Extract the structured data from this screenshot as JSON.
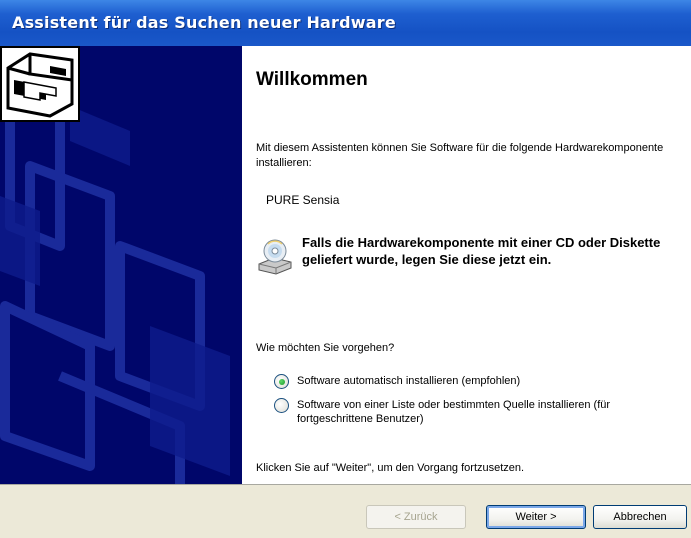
{
  "window": {
    "title": "Assistent für das Suchen neuer Hardware"
  },
  "content": {
    "heading": "Willkommen",
    "intro": "Mit diesem Assistenten können Sie Software für die folgende Hardwarekomponente installieren:",
    "device_name": "PURE Sensia",
    "notice": "Falls die Hardwarekomponente mit einer CD oder Diskette geliefert wurde, legen Sie diese jetzt ein.",
    "question": "Wie möchten Sie vorgehen?",
    "options": [
      {
        "label": "Software automatisch installieren (empfohlen)",
        "selected": true
      },
      {
        "label": "Software von einer Liste oder bestimmten Quelle installieren (für fortgeschrittene Benutzer)",
        "selected": false
      }
    ],
    "hint": "Klicken Sie auf \"Weiter\", um den Vorgang fortzusetzen."
  },
  "buttons": {
    "back": "< Zurück",
    "next": "Weiter >",
    "cancel": "Abbrechen"
  },
  "colors": {
    "titlebar": "#1552c4",
    "sidepanel": "#00066a",
    "footer": "#ece9d8"
  },
  "icons": {
    "wizard": "hardware-wizard-icon",
    "cd": "cd-drive-icon"
  }
}
